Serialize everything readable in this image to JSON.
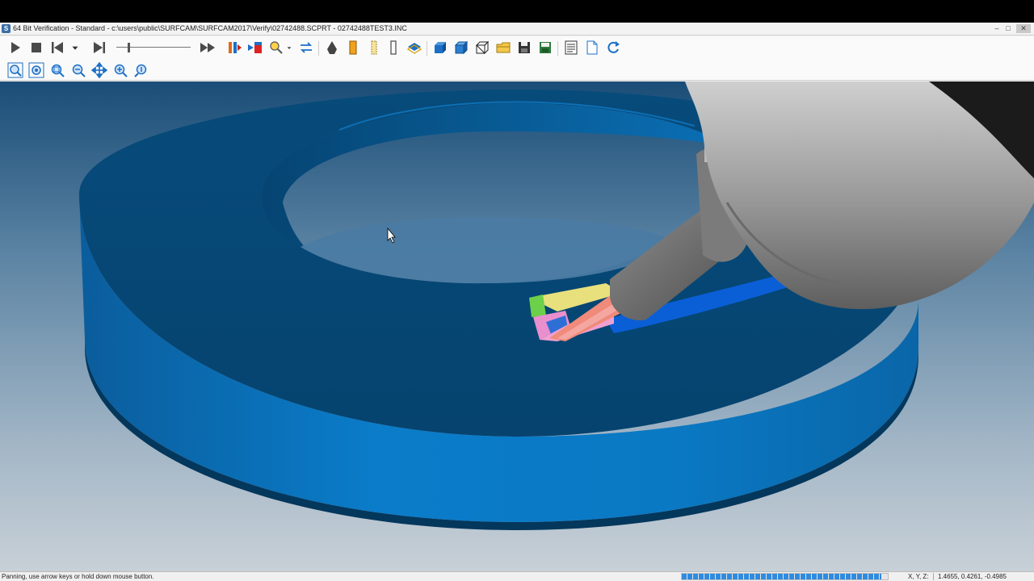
{
  "window": {
    "title": "64 Bit Verification - Standard - c:\\users\\public\\SURFCAM\\SURFCAM2017\\Verify\\02742488.SCPRT - 02742488TEST3.INC",
    "app_icon": "S",
    "minimize_glyph": "‒",
    "maximize_glyph": "□",
    "close_glyph": "✕"
  },
  "toolbar1": {
    "icons": [
      "play-icon",
      "stop-icon",
      "skip-to-start-icon",
      "dropdown-arrow-icon",
      "step-forward-icon",
      "speed-slider",
      "fast-forward-icon",
      "single-step-icon",
      "run-to-icon",
      "zoom-tool-icon",
      "swap-arrows-icon",
      "tool-view-icon",
      "holder-view-icon",
      "ruler-icon",
      "measure-icon",
      "layer-icon",
      "solid-cube-icon",
      "shaded-cube-icon",
      "wire-cube-icon",
      "open-folder-icon",
      "save-icon",
      "save-stl-icon",
      "report-icon",
      "new-document-icon",
      "refresh-icon"
    ],
    "speed_level": 0.15
  },
  "toolbar2": {
    "icons": [
      "zoom-fit-icon",
      "zoom-all-icon",
      "zoom-window-icon",
      "zoom-out-icon",
      "pan-icon",
      "zoom-in-icon",
      "zoom-dynamic-icon"
    ]
  },
  "colors": {
    "part_blue": "#0a78c4",
    "part_dark": "#06406a",
    "tool_gray": "#9a9a9a",
    "progress_blue": "#2f8be0"
  },
  "status": {
    "message": "Panning, use arrow keys or hold down mouse button.",
    "progress": 0.97,
    "coord_label": "X, Y, Z:",
    "coord_value": "1.4655, 0.4261, -0.4985"
  }
}
